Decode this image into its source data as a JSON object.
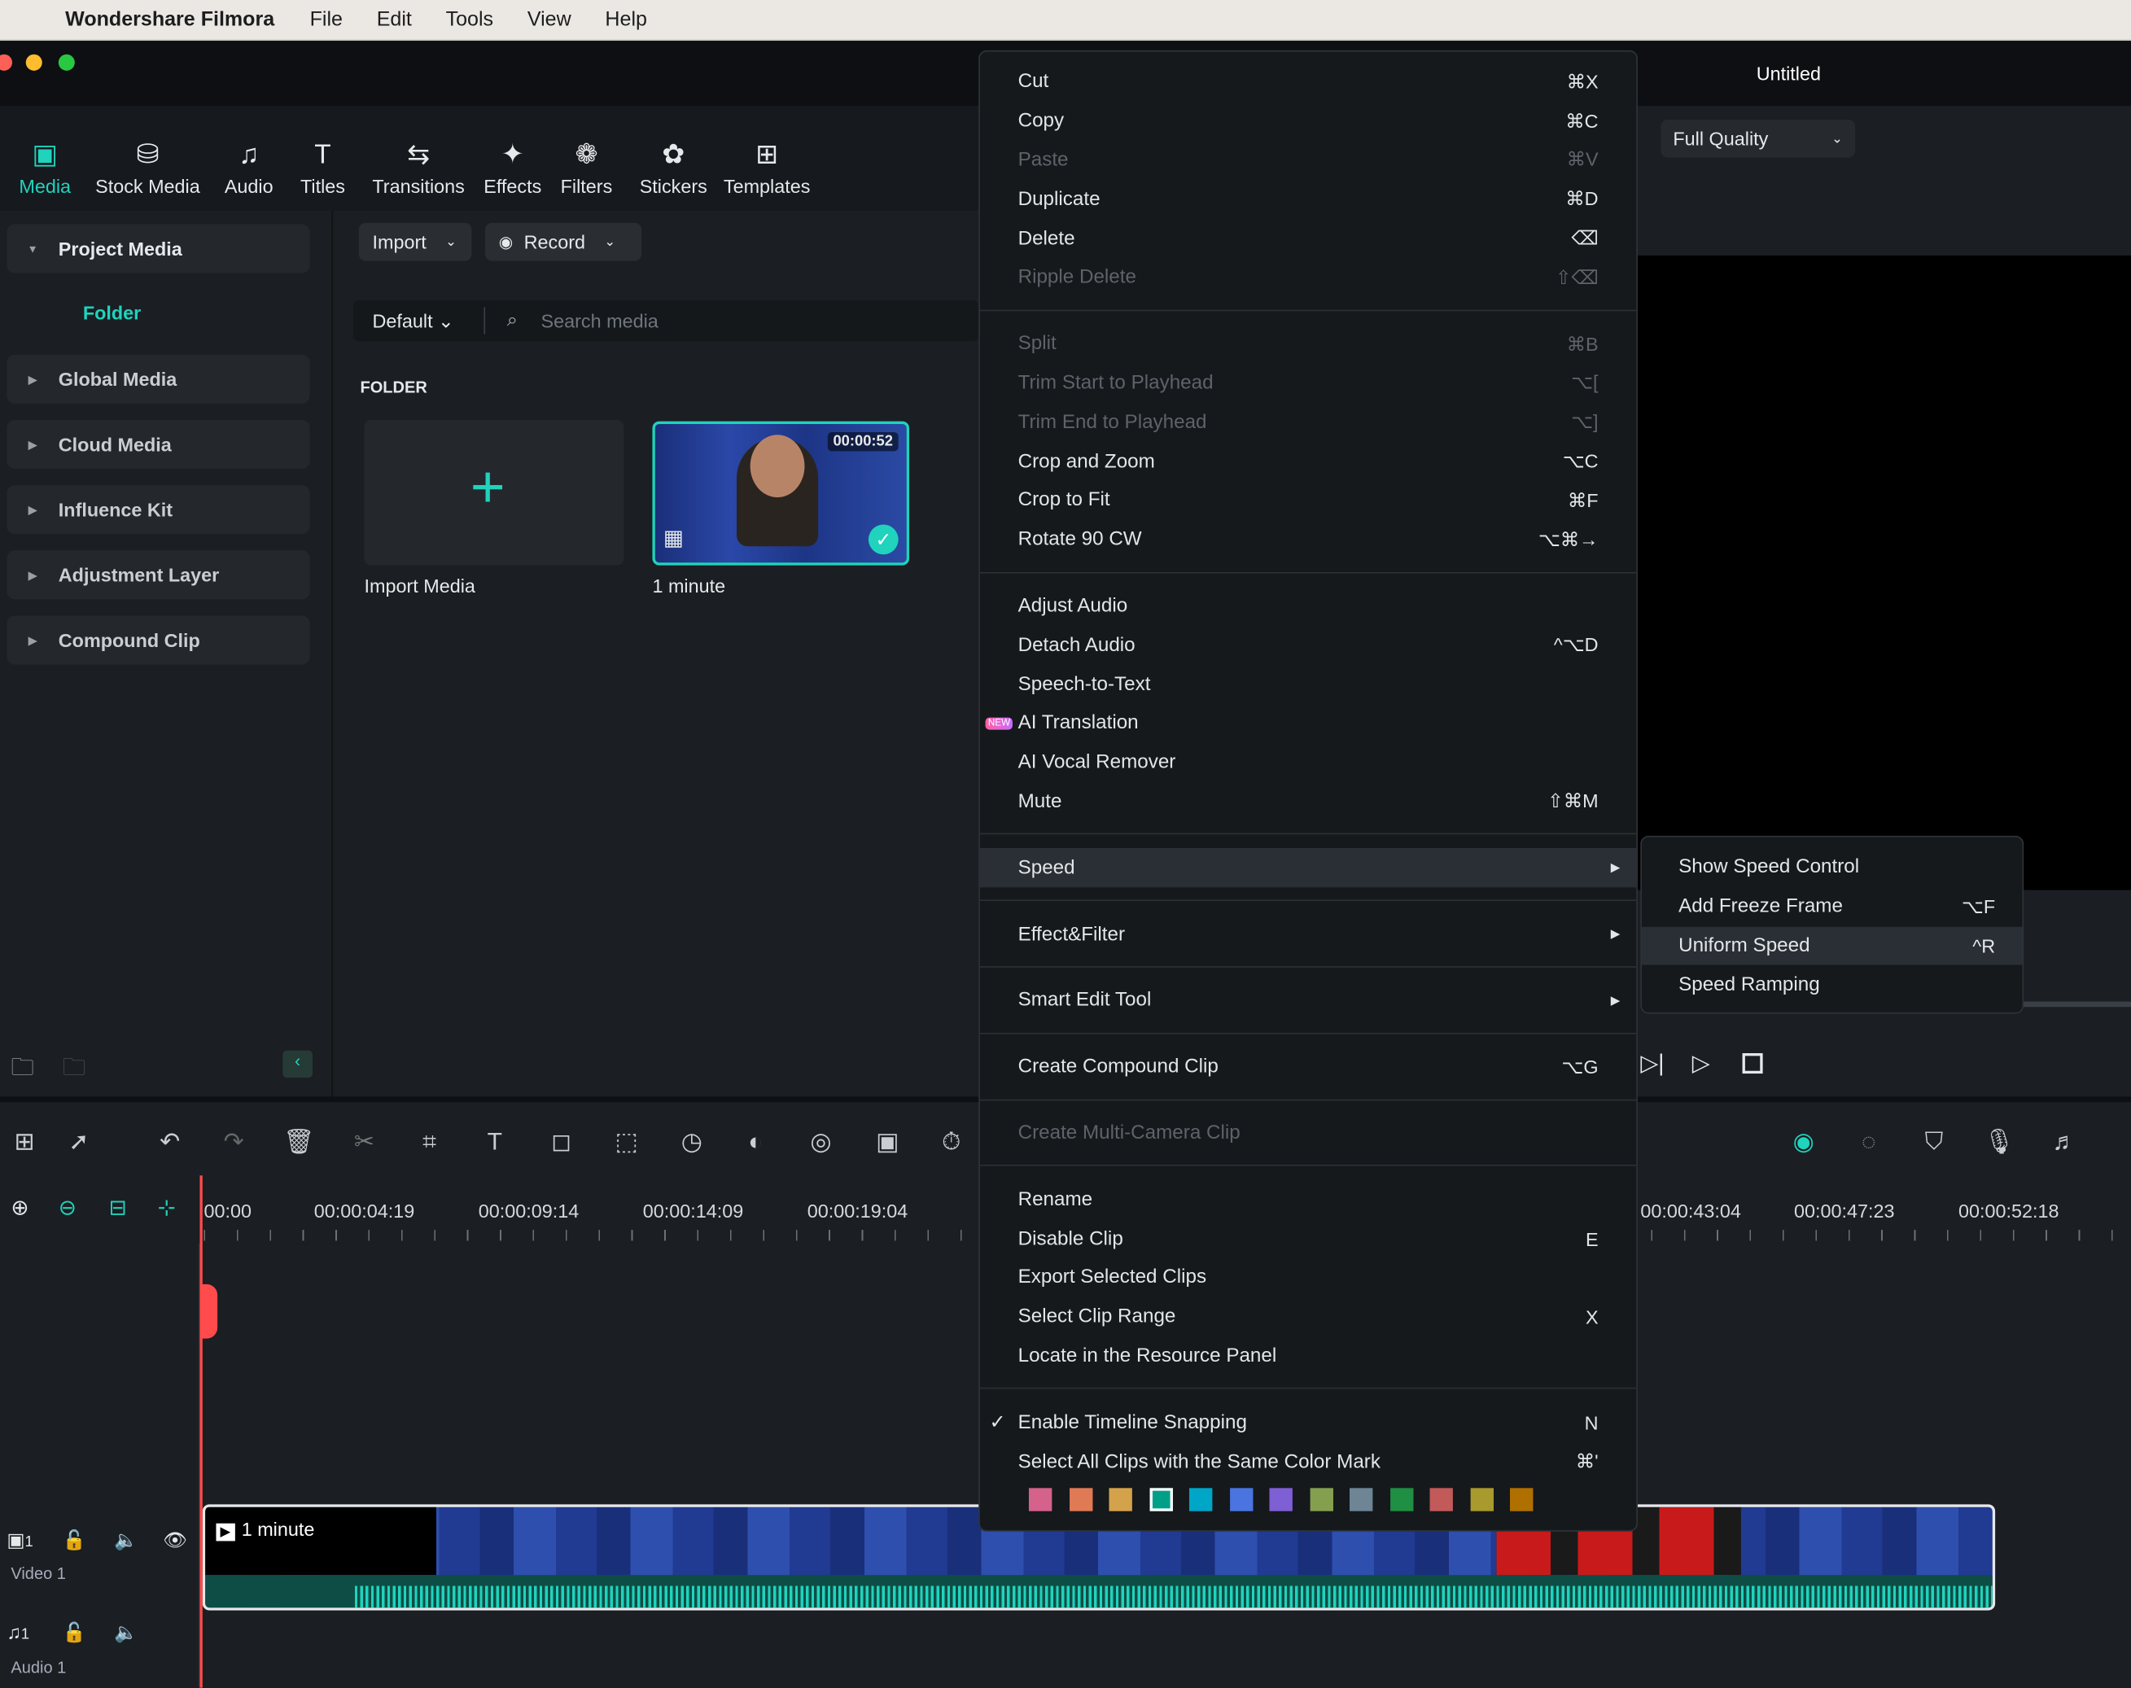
{
  "menubar": {
    "app": "Wondershare Filmora",
    "items": [
      "File",
      "Edit",
      "Tools",
      "View",
      "Help"
    ]
  },
  "window": {
    "title": "Untitled"
  },
  "toolbar": {
    "tabs": [
      {
        "label": "Media",
        "icon": "media-icon",
        "glyph": "▣",
        "active": true
      },
      {
        "label": "Stock Media",
        "icon": "stock-media-icon",
        "glyph": "⛁"
      },
      {
        "label": "Audio",
        "icon": "music-note-icon",
        "glyph": "♫"
      },
      {
        "label": "Titles",
        "icon": "text-icon",
        "glyph": "T"
      },
      {
        "label": "Transitions",
        "icon": "transitions-icon",
        "glyph": "⇆"
      },
      {
        "label": "Effects",
        "icon": "effects-icon",
        "glyph": "✦"
      },
      {
        "label": "Filters",
        "icon": "filters-icon",
        "glyph": "❁"
      },
      {
        "label": "Stickers",
        "icon": "stickers-icon",
        "glyph": "✿"
      },
      {
        "label": "Templates",
        "icon": "templates-icon",
        "glyph": "⊞"
      }
    ]
  },
  "sidebar": {
    "items": [
      "Project Media",
      "Global Media",
      "Cloud Media",
      "Influence Kit",
      "Adjustment Layer",
      "Compound Clip"
    ],
    "folder": "Folder"
  },
  "media": {
    "import": "Import",
    "record": "Record",
    "sort": "Default",
    "search_placeholder": "Search media",
    "section": "FOLDER",
    "import_card": "Import Media",
    "clip": {
      "name": "1 minute",
      "duration": "00:00:52"
    }
  },
  "preview": {
    "quality": "Full Quality"
  },
  "timeline": {
    "ruler": [
      "00:00",
      "00:00:04:19",
      "00:00:09:14",
      "00:00:14:09",
      "00:00:19:04",
      "00:00:43:04",
      "00:00:47:23",
      "00:00:52:18"
    ],
    "tracks": [
      {
        "num": "1",
        "name": "Video 1"
      },
      {
        "num": "1",
        "name": "Audio 1"
      }
    ],
    "clip_name": "1 minute"
  },
  "context_menu": {
    "groups": [
      [
        {
          "label": "Cut",
          "shortcut": "⌘X"
        },
        {
          "label": "Copy",
          "shortcut": "⌘C"
        },
        {
          "label": "Paste",
          "shortcut": "⌘V",
          "disabled": true
        },
        {
          "label": "Duplicate",
          "shortcut": "⌘D"
        },
        {
          "label": "Delete",
          "shortcut": "⌫"
        },
        {
          "label": "Ripple Delete",
          "shortcut": "⇧⌫",
          "disabled": true
        }
      ],
      [
        {
          "label": "Split",
          "shortcut": "⌘B",
          "disabled": true
        },
        {
          "label": "Trim Start to Playhead",
          "shortcut": "⌥[",
          "disabled": true
        },
        {
          "label": "Trim End to Playhead",
          "shortcut": "⌥]",
          "disabled": true
        },
        {
          "label": "Crop and Zoom",
          "shortcut": "⌥C"
        },
        {
          "label": "Crop to Fit",
          "shortcut": "⌘F"
        },
        {
          "label": "Rotate 90 CW",
          "shortcut": "⌥⌘→"
        }
      ],
      [
        {
          "label": "Adjust Audio",
          "shortcut": ""
        },
        {
          "label": "Detach Audio",
          "shortcut": "^⌥D"
        },
        {
          "label": "Speech-to-Text",
          "shortcut": ""
        },
        {
          "label": "AI Translation",
          "shortcut": "",
          "badge": "NEW"
        },
        {
          "label": "AI Vocal Remover",
          "shortcut": ""
        },
        {
          "label": "Mute",
          "shortcut": "⇧⌘M"
        }
      ],
      [
        {
          "label": "Speed",
          "submenu": true,
          "highlighted": true
        }
      ],
      [
        {
          "label": "Effect&Filter",
          "submenu": true
        }
      ],
      [
        {
          "label": "Smart Edit Tool",
          "submenu": true
        }
      ],
      [
        {
          "label": "Create Compound Clip",
          "shortcut": "⌥G"
        }
      ],
      [
        {
          "label": "Create Multi-Camera Clip",
          "shortcut": "",
          "disabled": true
        }
      ],
      [
        {
          "label": "Rename",
          "shortcut": ""
        },
        {
          "label": "Disable Clip",
          "shortcut": "E"
        },
        {
          "label": "Export Selected Clips",
          "shortcut": ""
        },
        {
          "label": "Select Clip Range",
          "shortcut": "X"
        },
        {
          "label": "Locate in the Resource Panel",
          "shortcut": ""
        }
      ],
      [
        {
          "label": "Enable Timeline Snapping",
          "shortcut": "N",
          "checked": true
        },
        {
          "label": "Select All Clips with the Same Color Mark",
          "shortcut": "⌘'"
        }
      ]
    ],
    "color_marks": [
      "#d4628a",
      "#e07a55",
      "#d4a24a",
      "#00a088",
      "#00a6c8",
      "#4a74e0",
      "#7e5fd4",
      "#84a04e",
      "#6d8594",
      "#1f8f44",
      "#c25a5a",
      "#a89a2c",
      "#b07000"
    ],
    "selected_color": 3
  },
  "speed_submenu": [
    {
      "label": "Show Speed Control",
      "shortcut": ""
    },
    {
      "label": "Add Freeze Frame",
      "shortcut": "⌥F"
    },
    {
      "label": "Uniform Speed",
      "shortcut": "^R",
      "highlighted": true
    },
    {
      "label": "Speed Ramping",
      "shortcut": ""
    }
  ],
  "colors": {
    "accent": "#1fd3bd",
    "playhead": "#ff4b4b"
  }
}
